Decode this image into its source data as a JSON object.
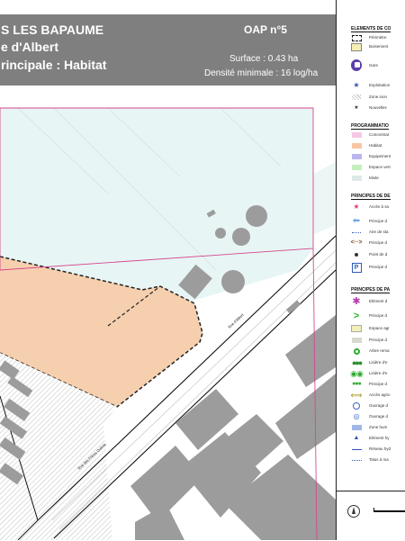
{
  "header": {
    "commune": "S LES BAPAUME",
    "street": "e d'Albert",
    "vocation": "rincipale : Habitat",
    "oap_number": "OAP n°5",
    "surface": "Surface : 0.43 ha",
    "densite": "Densité minimale : 16 log/ha"
  },
  "map": {
    "street_label_1": "Rue d'Albert",
    "street_label_2": "Rue des Frères Dubois",
    "colors": {
      "habitat": "#f6cfae",
      "mixte": "#e7f6f4",
      "perimeter": "#d6478f",
      "building": "#9c9c9c",
      "hatch": "#c4c4c4"
    }
  },
  "legend": {
    "sections": [
      {
        "title": "ELEMENTS DE CO",
        "items": [
          {
            "label": "Périmètre",
            "icon": "dashed-rect-icon"
          },
          {
            "label": "Boisement",
            "icon": "woodland-icon"
          },
          {
            "label": "Gare",
            "icon": "train-station-icon"
          },
          {
            "label": "Exploitation",
            "icon": "star-icon"
          },
          {
            "label": "Zone inon",
            "icon": "hatch-icon"
          },
          {
            "label": "Nouvelles",
            "icon": "small-star-icon"
          }
        ]
      },
      {
        "title": "PROGRAMMATIO",
        "items": [
          {
            "label": "Concentrat",
            "color": "#f5c8e4"
          },
          {
            "label": "Habitat",
            "color": "#f6c7a2"
          },
          {
            "label": "Equipement",
            "color": "#b9b6ef"
          },
          {
            "label": "Espace vert",
            "color": "#c3f0bd"
          },
          {
            "label": "Mixte",
            "color": "#dde9e9"
          }
        ]
      },
      {
        "title": "PRINCIPES DE DE",
        "items": [
          {
            "label": "Accès à sa",
            "icon": "access-star-icon"
          },
          {
            "label": "Principe d",
            "icon": "arrow-left-icon"
          },
          {
            "label": "Aire de sta",
            "icon": "dotted-line-icon"
          },
          {
            "label": "Principe d",
            "icon": "double-arrow-icon"
          },
          {
            "label": "Point de d",
            "icon": "dot-icon"
          },
          {
            "label": "Principe d",
            "icon": "parking-icon"
          }
        ]
      },
      {
        "title": "PRINCIPES DE PA",
        "items": [
          {
            "label": "Elément d",
            "icon": "flower-icon"
          },
          {
            "label": "Principe d",
            "icon": "chevron-right-icon"
          },
          {
            "label": "Espace agr",
            "icon": "yellow-square-icon"
          },
          {
            "label": "Principe d",
            "icon": "grey-square-icon"
          },
          {
            "label": "Arbre rema",
            "icon": "tree-icon"
          },
          {
            "label": "Lisière d'e",
            "icon": "hedge-icon"
          },
          {
            "label": "Lisière d'e",
            "icon": "double-circle-icon"
          },
          {
            "label": "Principe d",
            "icon": "green-dots-icon"
          },
          {
            "label": "Accès agrio",
            "icon": "double-arrow-yellow-icon"
          },
          {
            "label": "Ouvrage d",
            "icon": "blue-ring-icon"
          },
          {
            "label": "Ouvrage d",
            "icon": "blue-target-icon"
          },
          {
            "label": "Zone hum",
            "icon": "blue-rect-icon"
          },
          {
            "label": "Elément hy",
            "icon": "triangle-icon"
          },
          {
            "label": "Réseau hyd",
            "icon": "blue-line-icon"
          },
          {
            "label": "Talus à ma",
            "icon": "dotted-blue-line-icon"
          }
        ]
      }
    ]
  }
}
